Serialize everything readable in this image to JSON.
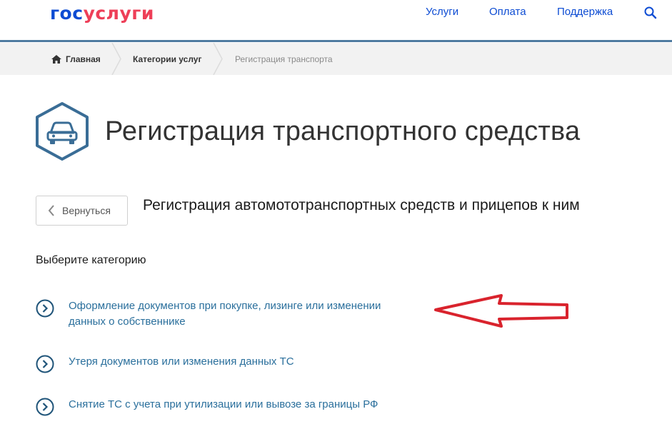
{
  "header": {
    "logo_part1": "гос",
    "logo_part2": "услуги",
    "nav": [
      "Услуги",
      "Оплата",
      "Поддержка"
    ],
    "search_icon": "search-icon",
    "brand_color": "#0d4cd3",
    "accent_color": "#ee3f58"
  },
  "breadcrumbs": {
    "home": "Главная",
    "category": "Категории услуг",
    "current": "Регистрация транспорта",
    "home_icon": "home-icon"
  },
  "page": {
    "title": "Регистрация транспортного средства",
    "icon": "car-icon",
    "back_label": "Вернуться",
    "subtitle": "Регистрация автомототранспортных средств и прицепов к ним",
    "choose_label": "Выберите категорию"
  },
  "categories": [
    {
      "line1": "Оформление документов при покупке, лизинге или изменении",
      "line2": "данных о собственнике"
    },
    {
      "line1": "Утеря документов или изменения данных ТС"
    },
    {
      "line1": "Снятие ТС с учета при утилизации или вывозе за границы РФ"
    }
  ],
  "annotation": {
    "arrow_color": "#d9232d"
  }
}
